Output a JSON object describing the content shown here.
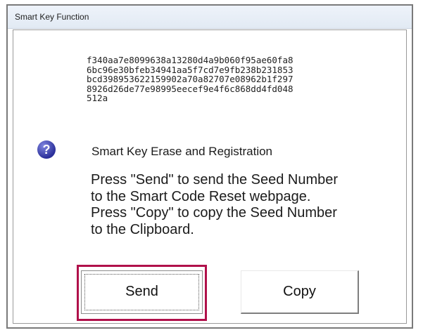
{
  "window": {
    "title": "Smart Key Function"
  },
  "seed": {
    "lines": [
      "f340aa7e8099638a13280d4a9b060f95ae60fa8",
      "6bc96e30bfeb34941aa5f7cd7e9fb238b231853",
      "bcd398953622159902a70a82707e08962b1f297",
      "8926d26de77e98995eecef9e4f6c868dd4fd048",
      "512a"
    ]
  },
  "dialog": {
    "icon": "question-icon",
    "icon_glyph": "?",
    "heading": "Smart Key Erase and Registration",
    "instructions": [
      "Press \"Send\" to send the Seed Number",
      "to the Smart Code Reset webpage.",
      "Press \"Copy\" to copy the Seed Number",
      "to the Clipboard."
    ]
  },
  "buttons": {
    "send_label": "Send",
    "copy_label": "Copy"
  },
  "colors": {
    "highlight": "#b0104a",
    "icon": "#2b2f9a"
  }
}
